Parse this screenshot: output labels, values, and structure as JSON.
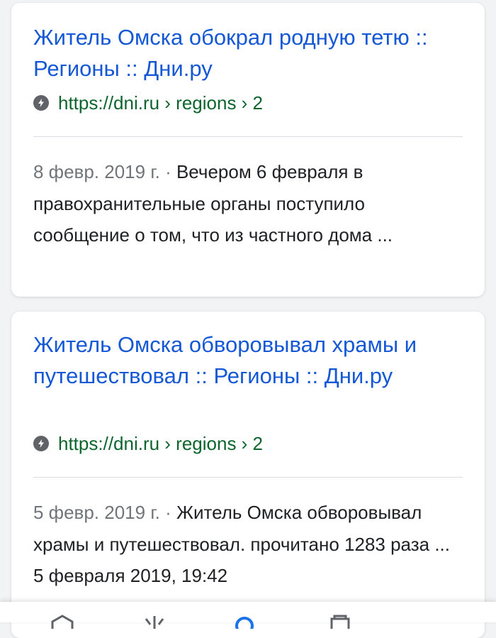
{
  "results": [
    {
      "title": "Житель Омска обокрал родную тетю :: Регионы :: Дни.ру",
      "url": "https://dni.ru › regions › 2",
      "date": "8 февр. 2019 г. · ",
      "snippet": "Вечером 6 февраля в правохранительные органы поступило сообщение о том, что из частного дома ..."
    },
    {
      "title": "Житель Омска обворовывал храмы и путешествовал :: Регионы :: Дни.ру",
      "url": "https://dni.ru › regions › 2",
      "date": "5 февр. 2019 г. · ",
      "snippet": "Житель Омска обворовывал храмы и путешествовал. прочитано 1283 раза ... 5 февраля 2019, 19:42"
    }
  ],
  "bottom_nav": {
    "items": [
      {
        "icon": "home-icon"
      },
      {
        "icon": "discover-icon"
      },
      {
        "icon": "search-icon"
      },
      {
        "icon": "collections-icon"
      }
    ]
  },
  "colors": {
    "title": "#1558d6",
    "url": "#0d652d",
    "date": "#70757a",
    "snippet": "#202124",
    "background": "#f1f3f4",
    "active_nav": "#1a73e8"
  }
}
